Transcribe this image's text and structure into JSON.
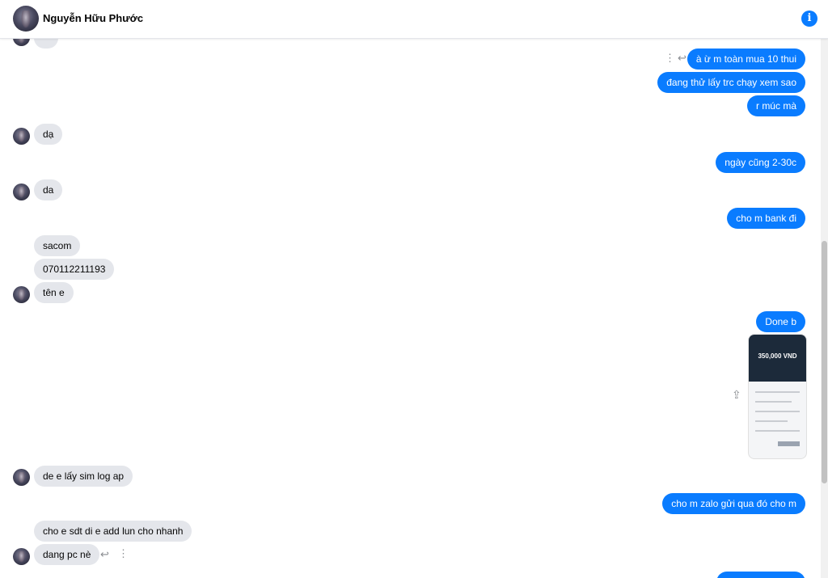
{
  "header": {
    "contact_name": "Nguyễn Hữu Phước",
    "info_icon": "info-icon",
    "info_glyph": "i"
  },
  "messages": {
    "out1": "à ừ m toàn mua 10 thui",
    "out2": "đang thử lấy trc chạy xem sao",
    "out3": "r múc mà",
    "in1": "dạ",
    "out4": "ngày cũng 2-30c",
    "in2": "da",
    "out5": "cho m bank đi",
    "in3": "sacom",
    "in4": "070112211193",
    "in5": "tên e",
    "out6": "Done b",
    "photo_amount": "350,000 VND",
    "in6": "de e lấy sim log ap",
    "out7": "cho m zalo gửi qua đó cho m",
    "in7": "cho e sdt di e add lun cho nhanh",
    "in8": "dang pc nè"
  },
  "icons": {
    "more": "⋮",
    "reply": "↩",
    "share": "⇪"
  },
  "colors": {
    "accent": "#0a7cff",
    "incoming_bubble": "#e4e6eb"
  }
}
